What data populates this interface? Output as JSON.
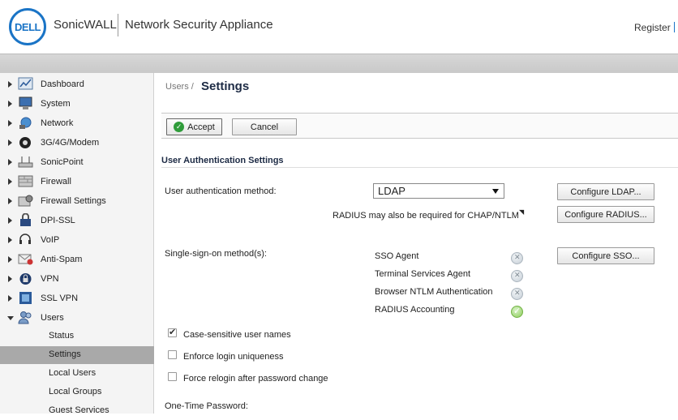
{
  "header": {
    "logo_text": "DELL",
    "brand": "SonicWALL",
    "product": "Network Security Appliance",
    "register_link": "Register"
  },
  "sidebar": {
    "items": [
      {
        "label": "Dashboard",
        "icon": "dashboard-icon"
      },
      {
        "label": "System",
        "icon": "monitor-icon"
      },
      {
        "label": "Network",
        "icon": "network-icon"
      },
      {
        "label": "3G/4G/Modem",
        "icon": "modem-icon"
      },
      {
        "label": "SonicPoint",
        "icon": "access-point-icon"
      },
      {
        "label": "Firewall",
        "icon": "firewall-icon"
      },
      {
        "label": "Firewall Settings",
        "icon": "firewall-settings-icon"
      },
      {
        "label": "DPI-SSL",
        "icon": "lock-icon"
      },
      {
        "label": "VoIP",
        "icon": "headset-icon"
      },
      {
        "label": "Anti-Spam",
        "icon": "mail-icon"
      },
      {
        "label": "VPN",
        "icon": "vpn-lock-icon"
      },
      {
        "label": "SSL VPN",
        "icon": "ssl-vpn-icon"
      },
      {
        "label": "Users",
        "icon": "users-icon"
      }
    ],
    "users_sub": [
      "Status",
      "Settings",
      "Local Users",
      "Local Groups",
      "Guest Services"
    ],
    "active_sub": "Settings"
  },
  "breadcrumb": "Users /",
  "page_title": "Settings",
  "toolbar": {
    "accept": "Accept",
    "cancel": "Cancel"
  },
  "section": {
    "title": "User Authentication Settings",
    "auth_method_label": "User authentication method:",
    "auth_method_value": "LDAP",
    "radius_note": "RADIUS may also be required for CHAP/NTLM",
    "configure_ldap": "Configure LDAP...",
    "configure_radius": "Configure RADIUS...",
    "sso_label": "Single-sign-on method(s):",
    "configure_sso": "Configure SSO...",
    "sso_methods": [
      {
        "label": "SSO Agent",
        "enabled": false
      },
      {
        "label": "Terminal Services Agent",
        "enabled": false
      },
      {
        "label": "Browser NTLM Authentication",
        "enabled": false
      },
      {
        "label": "RADIUS Accounting",
        "enabled": true
      }
    ],
    "options": [
      {
        "label": "Case-sensitive user names",
        "checked": true
      },
      {
        "label": "Enforce login uniqueness",
        "checked": false
      },
      {
        "label": "Force relogin after password change",
        "checked": false
      }
    ],
    "otp_label": "One-Time Password:"
  }
}
